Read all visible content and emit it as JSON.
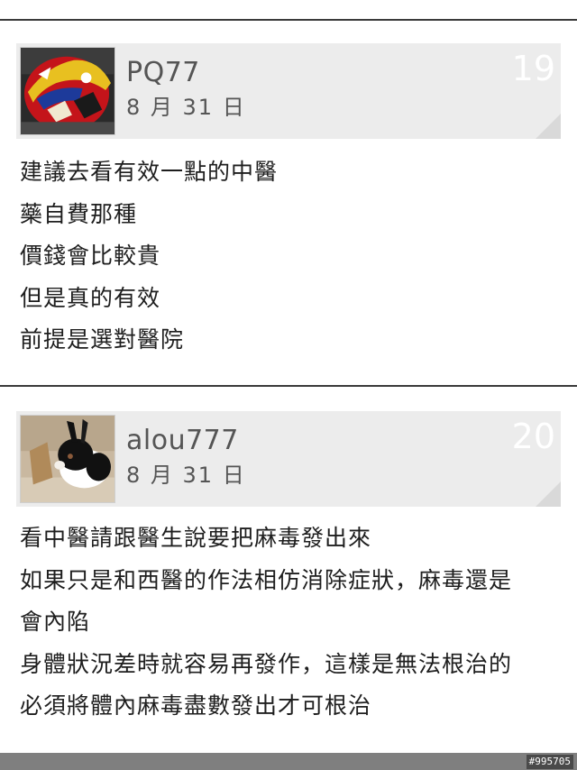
{
  "posts": [
    {
      "username": "PQ77",
      "date": "8 月 31 日",
      "floor": "19",
      "avatar_icon": "motorcycle-helmet-photo",
      "lines": [
        "建議去看有效一點的中醫",
        "藥自費那種",
        "價錢會比較貴",
        "但是真的有效",
        "前提是選對醫院"
      ]
    },
    {
      "username": "alou777",
      "date": "8 月 31 日",
      "floor": "20",
      "avatar_icon": "rabbit-photo",
      "lines": [
        "看中醫請跟醫生說要把麻毒發出來",
        "如果只是和西醫的作法相仿消除症狀，麻毒還是",
        "會內陷",
        "身體狀況差時就容易再發作，這樣是無法根治的",
        "必須將體內麻毒盡數發出才可根治"
      ]
    }
  ],
  "watermark": "#995705",
  "colors": {
    "header_bg": "#ececec",
    "divider": "#3a3a3a",
    "bottom_bar": "#7f7f7f"
  }
}
